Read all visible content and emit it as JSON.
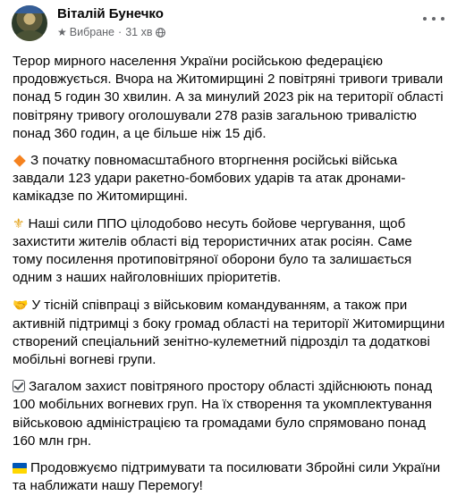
{
  "author": {
    "name": "Віталій Бунечко",
    "favorites_label": "Вибране",
    "time": "31 хв",
    "audience_icon": "globe-icon",
    "favorites_icon": "star-icon"
  },
  "post": {
    "paragraphs": [
      {
        "emoji": "",
        "text": "Терор мирного населення України російською федерацією продовжується. Вчора на Житомирщині 2 повітряні тривоги тривали понад 5 годин 30 хвилин. А за минулий 2023 рік на території області повітряну тривогу оголошували 278 разів загальною тривалістю понад 360 годин, а це більше ніж 15 діб."
      },
      {
        "emoji": "orange-diamond",
        "text": "З початку повномасштабного вторгнення російські війська завдали 123 удари ракетно-бомбових ударів та атак дронами-камікадзе по Житомирщині."
      },
      {
        "emoji": "fleur-de-lis",
        "text": "Наші сили ППО цілодобово несуть бойове чергування, щоб захистити жителів області від терористичних атак росіян. Саме тому  посилення протиповітряної оборони було та залишається одним з наших найголовніших пріоритетів."
      },
      {
        "emoji": "handshake",
        "text": "У тісній співпраці з військовим командуванням, а також при активній підтримці з боку громад області на території Житомирщини створений спеціальний зенітно-кулеметний підрозділ та додаткові мобільні вогневі групи."
      },
      {
        "emoji": "check-box",
        "text": "Загалом захист повітряного простору області здійснюють понад 100 мобільних вогневих груп. На їх створення та укомплектування військовою адміністрацією та громадами було спрямовано понад 160 млн грн."
      },
      {
        "emoji": "ukraine-flag",
        "text": "Продовжуємо підтримувати та посилювати Збройні сили України та наближати нашу Перемогу!"
      }
    ]
  },
  "colors": {
    "text": "#050505",
    "secondary_text": "#65676b",
    "diamond": "#f5821f",
    "flag_blue": "#0057b7",
    "flag_yellow": "#ffd700"
  }
}
